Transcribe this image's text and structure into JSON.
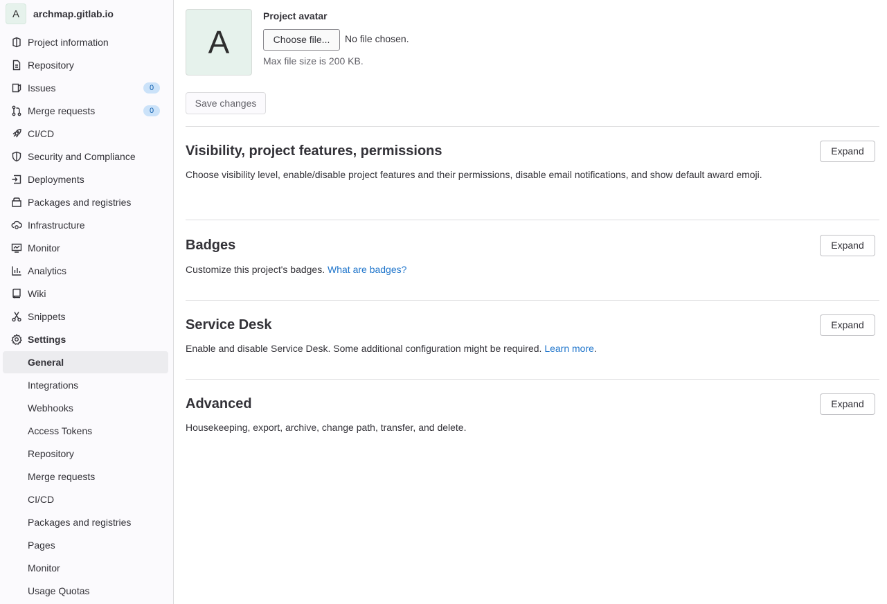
{
  "project": {
    "initial": "A",
    "name": "archmap.gitlab.io"
  },
  "nav": {
    "items": [
      {
        "label": "Project information",
        "icon": "project-icon"
      },
      {
        "label": "Repository",
        "icon": "document-icon"
      },
      {
        "label": "Issues",
        "icon": "issues-icon",
        "count": "0"
      },
      {
        "label": "Merge requests",
        "icon": "merge-request-icon",
        "count": "0"
      },
      {
        "label": "CI/CD",
        "icon": "rocket-icon"
      },
      {
        "label": "Security and Compliance",
        "icon": "shield-icon"
      },
      {
        "label": "Deployments",
        "icon": "deployments-icon"
      },
      {
        "label": "Packages and registries",
        "icon": "package-icon"
      },
      {
        "label": "Infrastructure",
        "icon": "cloud-gear-icon"
      },
      {
        "label": "Monitor",
        "icon": "monitor-icon"
      },
      {
        "label": "Analytics",
        "icon": "chart-icon"
      },
      {
        "label": "Wiki",
        "icon": "book-icon"
      },
      {
        "label": "Snippets",
        "icon": "scissors-icon"
      },
      {
        "label": "Settings",
        "icon": "gear-icon"
      }
    ],
    "settings_sub": [
      "General",
      "Integrations",
      "Webhooks",
      "Access Tokens",
      "Repository",
      "Merge requests",
      "CI/CD",
      "Packages and registries",
      "Pages",
      "Monitor",
      "Usage Quotas"
    ]
  },
  "avatar": {
    "label": "Project avatar",
    "initial": "A",
    "choose_button": "Choose file...",
    "file_status": "No file chosen.",
    "hint": "Max file size is 200 KB."
  },
  "save_button": "Save changes",
  "sections": [
    {
      "title": "Visibility, project features, permissions",
      "desc": "Choose visibility level, enable/disable project features and their permissions, disable email notifications, and show default award emoji.",
      "expand": "Expand"
    },
    {
      "title": "Badges",
      "desc": "Customize this project's badges.",
      "link": "What are badges?",
      "expand": "Expand"
    },
    {
      "title": "Service Desk",
      "desc": "Enable and disable Service Desk. Some additional configuration might be required.",
      "link": "Learn more",
      "after": ".",
      "expand": "Expand"
    },
    {
      "title": "Advanced",
      "desc": "Housekeeping, export, archive, change path, transfer, and delete.",
      "expand": "Expand"
    }
  ],
  "colors": {
    "active_bg": "#ececef",
    "link": "#1f75cb",
    "badge_bg": "#cbe2f9",
    "badge_fg": "#0b5cad"
  }
}
